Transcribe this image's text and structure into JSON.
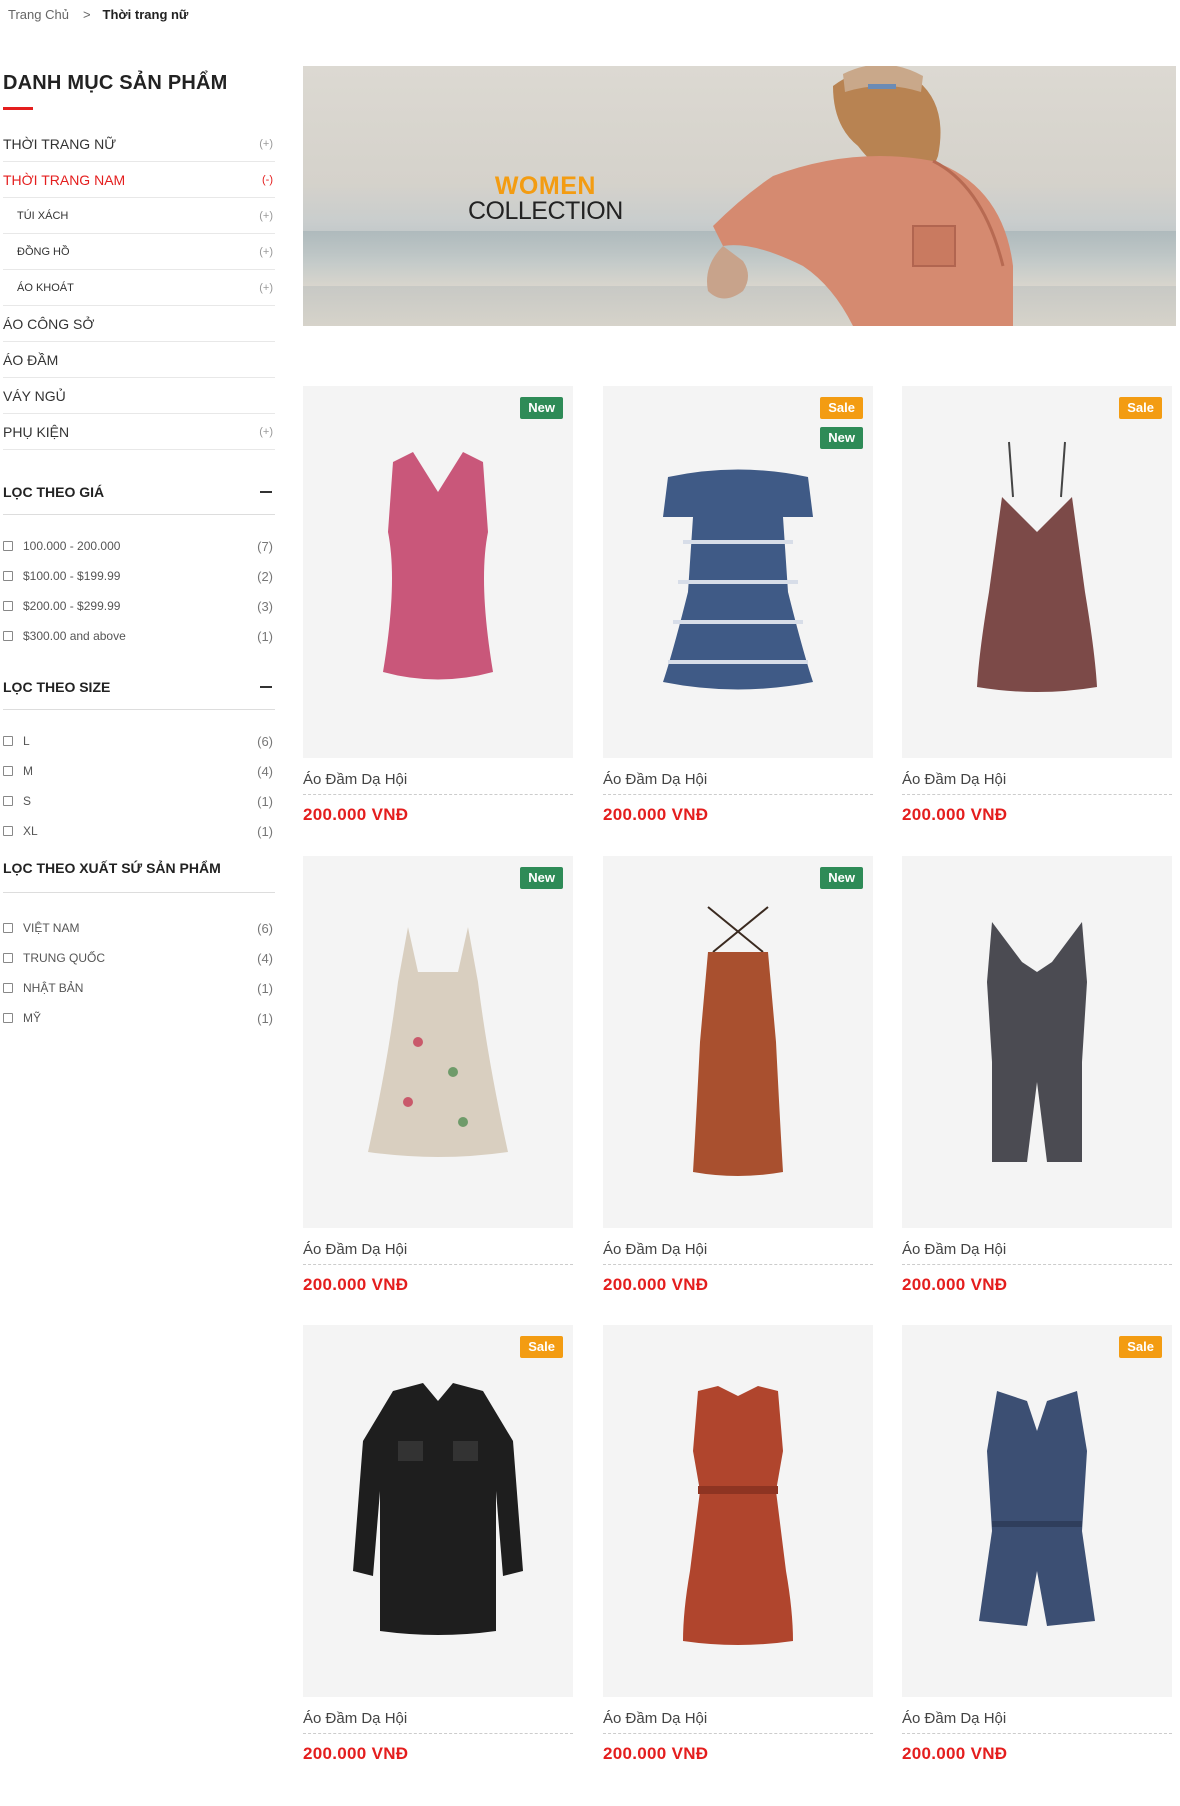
{
  "breadcrumb": {
    "home": "Trang Chủ",
    "separator": ">",
    "current": "Thời trang nữ"
  },
  "sidebar": {
    "title": "DANH MỤC SẢN PHẨM",
    "categories": [
      {
        "label": "THỜI TRANG NỮ",
        "toggle": "(+)"
      },
      {
        "label": "THỜI TRANG NAM",
        "toggle": "(-)"
      },
      {
        "label": "TÚI XÁCH",
        "toggle": "(+)"
      },
      {
        "label": "ĐỒNG HỒ",
        "toggle": "(+)"
      },
      {
        "label": "ÁO KHOÁT",
        "toggle": "(+)"
      },
      {
        "label": "ÁO CÔNG SỞ",
        "toggle": ""
      },
      {
        "label": "ÁO ĐẦM",
        "toggle": ""
      },
      {
        "label": "VÁY NGỦ",
        "toggle": ""
      },
      {
        "label": "PHỤ KIỆN",
        "toggle": "(+)"
      }
    ],
    "filters": {
      "price": {
        "title": "LỌC THEO GIÁ",
        "options": [
          {
            "label": "100.000 - 200.000",
            "count": "(7)"
          },
          {
            "label": "$100.00 - $199.99",
            "count": "(2)"
          },
          {
            "label": "$200.00 - $299.99",
            "count": "(3)"
          },
          {
            "label": "$300.00 and above",
            "count": "(1)"
          }
        ]
      },
      "size": {
        "title": "LỌC THEO SIZE",
        "options": [
          {
            "label": "L",
            "count": "(6)"
          },
          {
            "label": "M",
            "count": "(4)"
          },
          {
            "label": "S",
            "count": "(1)"
          },
          {
            "label": "XL",
            "count": "(1)"
          }
        ]
      },
      "origin": {
        "title": "LỌC THEO XUẤT SỨ SẢN PHẨM",
        "options": [
          {
            "label": "VIỆT NAM",
            "count": "(6)"
          },
          {
            "label": "TRUNG QUỐC",
            "count": "(4)"
          },
          {
            "label": "NHẬT BẢN",
            "count": "(1)"
          },
          {
            "label": "MỸ",
            "count": "(1)"
          }
        ]
      }
    }
  },
  "banner": {
    "line1": "WOMEN",
    "line2": "COLLECTION"
  },
  "colors": {
    "accent": "#e41e1e",
    "sale": "#f39c12",
    "new": "#2e8b57"
  },
  "products": [
    {
      "name": "Áo Đầm Dạ Hội",
      "price": "200.000 VNĐ",
      "badges": [
        "New"
      ],
      "color": "#c9577a"
    },
    {
      "name": "Áo Đầm Dạ Hội",
      "price": "200.000 VNĐ",
      "badges": [
        "Sale",
        "New"
      ],
      "color": "#3f5a86"
    },
    {
      "name": "Áo Đầm Dạ Hội",
      "price": "200.000 VNĐ",
      "badges": [
        "Sale"
      ],
      "color": "#7c4a48"
    },
    {
      "name": "Áo Đầm Dạ Hội",
      "price": "200.000 VNĐ",
      "badges": [
        "New"
      ],
      "color": "#d9cfc0"
    },
    {
      "name": "Áo Đầm Dạ Hội",
      "price": "200.000 VNĐ",
      "badges": [
        "New"
      ],
      "color": "#a9502f"
    },
    {
      "name": "Áo Đầm Dạ Hội",
      "price": "200.000 VNĐ",
      "badges": [],
      "color": "#4b4b52"
    },
    {
      "name": "Áo Đầm Dạ Hội",
      "price": "200.000 VNĐ",
      "badges": [
        "Sale"
      ],
      "color": "#1e1e1e"
    },
    {
      "name": "Áo Đầm Dạ Hội",
      "price": "200.000 VNĐ",
      "badges": [],
      "color": "#b0452d"
    },
    {
      "name": "Áo Đầm Dạ Hội",
      "price": "200.000 VNĐ",
      "badges": [
        "Sale"
      ],
      "color": "#3c4f73"
    }
  ]
}
